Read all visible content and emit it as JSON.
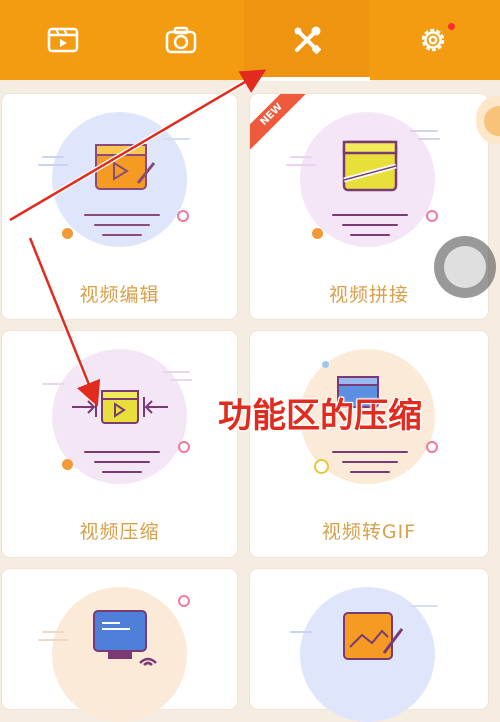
{
  "header": {
    "tabs": [
      {
        "icon": "video-clip-icon",
        "active": false
      },
      {
        "icon": "camera-icon",
        "active": false
      },
      {
        "icon": "tools-icon",
        "active": true
      },
      {
        "icon": "gear-icon",
        "active": false,
        "has_badge": true
      }
    ]
  },
  "features": [
    {
      "label": "视频编辑",
      "icon": "video-edit-icon",
      "circle_color": "#dfe6fb"
    },
    {
      "label": "视频拼接",
      "icon": "video-merge-icon",
      "circle_color": "#f4e6f6",
      "badge": "NEW"
    },
    {
      "label": "视频压缩",
      "icon": "video-compress-icon",
      "circle_color": "#f3e7f6"
    },
    {
      "label": "视频转GIF",
      "icon": "video-to-gif-icon",
      "circle_color": "#fbead7"
    },
    {
      "label": "",
      "icon": "screen-cast-icon",
      "circle_color": "#fbead7"
    },
    {
      "label": "",
      "icon": "image-edit-icon",
      "circle_color": "#dfe6fb"
    }
  ],
  "annotation": {
    "text": "功能区的压缩",
    "color": "#e12b1f"
  },
  "colors": {
    "accent": "#f39c12",
    "label": "#d8a04a"
  }
}
